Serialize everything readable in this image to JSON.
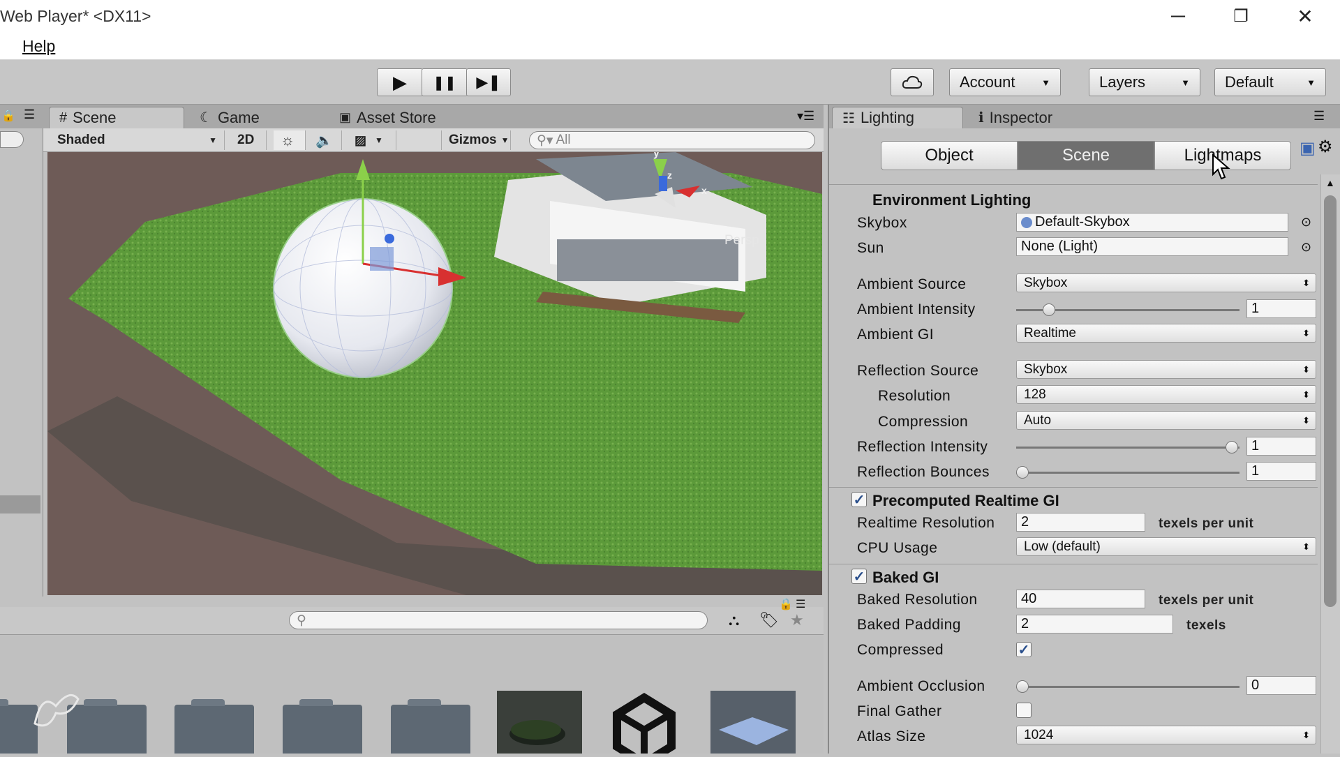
{
  "window": {
    "title": "Web Player* <DX11>",
    "minimize": "─",
    "restore": "❐",
    "close": "✕"
  },
  "menu": {
    "help": "Help"
  },
  "toolbar": {
    "play": "▶",
    "pause": "❚❚",
    "step": "▶❚",
    "account": "Account",
    "layers": "Layers",
    "layout": "Default"
  },
  "scene_tabs": {
    "scene": "Scene",
    "game": "Game",
    "asset_store": "Asset Store"
  },
  "scene_bar": {
    "shading": "Shaded",
    "mode_2d": "2D",
    "gizmos": "Gizmos",
    "search_placeholder": "All"
  },
  "viewport": {
    "persp_label": "Persp",
    "axis_y": "y",
    "axis_z": "z",
    "axis_x": "x"
  },
  "inspector_tabs": {
    "lighting": "Lighting",
    "inspector": "Inspector"
  },
  "segments": {
    "object": "Object",
    "scene": "Scene",
    "lightmaps": "Lightmaps"
  },
  "lighting": {
    "env_header": "Environment Lighting",
    "skybox_label": "Skybox",
    "skybox_value": "Default-Skybox",
    "sun_label": "Sun",
    "sun_value": "None (Light)",
    "ambient_source_label": "Ambient Source",
    "ambient_source_value": "Skybox",
    "ambient_intensity_label": "Ambient Intensity",
    "ambient_intensity_value": "1",
    "ambient_gi_label": "Ambient GI",
    "ambient_gi_value": "Realtime",
    "reflection_source_label": "Reflection Source",
    "reflection_source_value": "Skybox",
    "resolution_label": "Resolution",
    "resolution_value": "128",
    "compression_label": "Compression",
    "compression_value": "Auto",
    "reflection_intensity_label": "Reflection Intensity",
    "reflection_intensity_value": "1",
    "reflection_bounces_label": "Reflection Bounces",
    "reflection_bounces_value": "1",
    "precomputed_header": "Precomputed Realtime GI",
    "realtime_resolution_label": "Realtime Resolution",
    "realtime_resolution_value": "2",
    "texels_per_unit": "texels per unit",
    "cpu_usage_label": "CPU Usage",
    "cpu_usage_value": "Low (default)",
    "baked_header": "Baked GI",
    "baked_resolution_label": "Baked Resolution",
    "baked_resolution_value": "40",
    "baked_padding_label": "Baked Padding",
    "baked_padding_value": "2",
    "texels": "texels",
    "compressed_label": "Compressed",
    "ambient_occlusion_label": "Ambient Occlusion",
    "ambient_occlusion_value": "0",
    "final_gather_label": "Final Gather",
    "atlas_size_label": "Atlas Size",
    "atlas_size_value": "1024"
  },
  "slider_levels": {
    "ambient_intensity": 0.125,
    "reflection_intensity": 1.0,
    "reflection_bounces": 0.0,
    "ambient_occlusion": 0.0
  },
  "checks": {
    "precomputed_realtime_gi": true,
    "baked_gi": true,
    "compressed": true,
    "final_gather": false
  },
  "colors": {
    "grass": "#5c9a3a",
    "segment_active": "#6f6f6f"
  }
}
